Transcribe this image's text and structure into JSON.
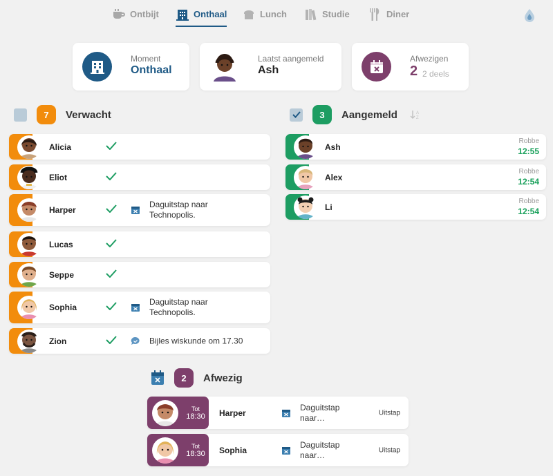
{
  "colors": {
    "primary": "#1f5a86",
    "orange": "#f28c0c",
    "green": "#1d9d62",
    "purple": "#7d3f6b"
  },
  "nav": {
    "tabs": [
      {
        "label": "Ontbijt",
        "icon": "coffee-cup-icon"
      },
      {
        "label": "Onthaal",
        "icon": "building-icon",
        "active": true
      },
      {
        "label": "Lunch",
        "icon": "bread-icon"
      },
      {
        "label": "Studie",
        "icon": "books-icon"
      },
      {
        "label": "Diner",
        "icon": "cutlery-icon"
      }
    ],
    "right_icon": "water-drop-icon"
  },
  "summary": {
    "moment": {
      "caption": "Moment",
      "value": "Onthaal"
    },
    "last": {
      "caption": "Laatst aangemeld",
      "value": "Ash"
    },
    "absent": {
      "caption": "Afwezigen",
      "count": "2",
      "detail": "2 deels"
    }
  },
  "expected": {
    "count": "7",
    "title": "Verwacht",
    "rows": [
      {
        "name": "Alicia",
        "note": ""
      },
      {
        "name": "Eliot",
        "note": ""
      },
      {
        "name": "Harper",
        "note_icon": "calendar-x-icon",
        "note_line1": "Daguitstap naar",
        "note_line2": "Technopolis."
      },
      {
        "name": "Lucas",
        "note": ""
      },
      {
        "name": "Seppe",
        "note": ""
      },
      {
        "name": "Sophia",
        "note_icon": "calendar-x-icon",
        "note_line1": "Daguitstap naar",
        "note_line2": "Technopolis."
      },
      {
        "name": "Zion",
        "note_icon": "chat-icon",
        "note_line1": "Bijles wiskunde om 17.30",
        "note_line2": ""
      }
    ]
  },
  "registered": {
    "count": "3",
    "title": "Aangemeld",
    "rows": [
      {
        "name": "Ash",
        "by": "Robbe",
        "time": "12:55"
      },
      {
        "name": "Alex",
        "by": "Robbe",
        "time": "12:54"
      },
      {
        "name": "Li",
        "by": "Robbe",
        "time": "12:54"
      }
    ]
  },
  "absent": {
    "count": "2",
    "title": "Afwezig",
    "rows": [
      {
        "name": "Harper",
        "tot": "Tot",
        "until": "18:30",
        "note_line1": "Daguitstap",
        "note_line2": "naar…",
        "state": "Uitstap"
      },
      {
        "name": "Sophia",
        "tot": "Tot",
        "until": "18:30",
        "note_line1": "Daguitstap",
        "note_line2": "naar…",
        "state": "Uitstap"
      }
    ]
  }
}
